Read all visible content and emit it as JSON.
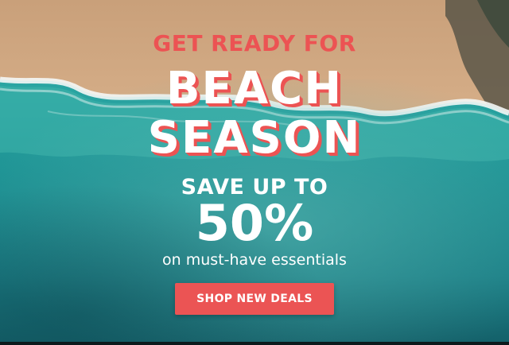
{
  "banner": {
    "headline_small": "GET READY FOR",
    "headline_big_line1": "BEACH",
    "headline_big_line2": "SEASON",
    "save_line": "SAVE UP TO",
    "percent": "50%",
    "subtext": "on must-have essentials",
    "cta_label": "SHOP NEW DEALS"
  },
  "colors": {
    "accent": "#ec5353",
    "text": "#ffffff",
    "sand": "#d9b28c",
    "water": "#1f8f95"
  }
}
